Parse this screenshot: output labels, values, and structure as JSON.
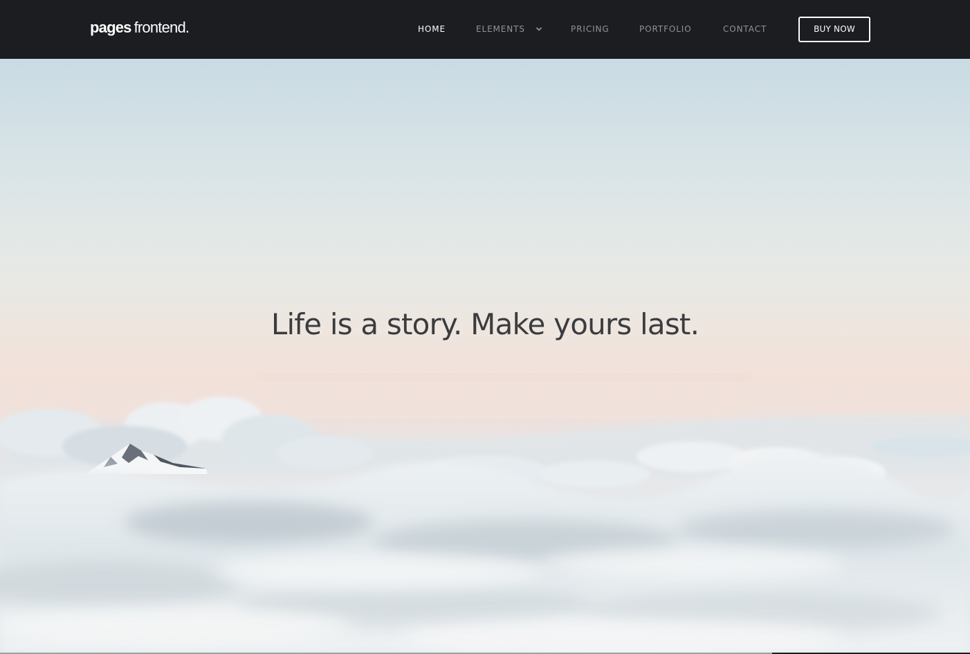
{
  "brand": {
    "name_bold": "pages",
    "name_light": "frontend."
  },
  "nav": {
    "items": [
      {
        "label": "HOME",
        "active": true
      },
      {
        "label": "ELEMENTS",
        "active": false,
        "icon": "chevron-down-icon"
      },
      {
        "label": "PRICING",
        "active": false
      },
      {
        "label": "PORTFOLIO",
        "active": false
      },
      {
        "label": "CONTACT",
        "active": false
      }
    ],
    "buy_button": "BUY NOW"
  },
  "hero": {
    "headline": "Life is a story. Make yours last.",
    "background": "sky-above-clouds-with-mountain-peak"
  },
  "colors": {
    "navbar_bg": "#1b1d20",
    "nav_active": "#ffffff",
    "nav_inactive": "#8f9499",
    "headline": "#3b3c3f"
  }
}
